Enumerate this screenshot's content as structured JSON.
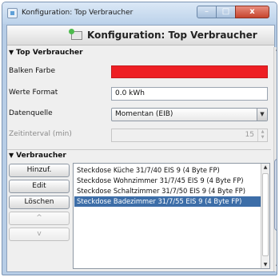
{
  "window": {
    "title": "Konfiguration: Top Verbraucher",
    "minimize_glyph": "–",
    "maximize_glyph": "□",
    "close_glyph": "x"
  },
  "header": {
    "title": "Konfiguration: Top Verbraucher",
    "icon": "add-widget-icon"
  },
  "settings": {
    "section_label": "Top Verbraucher",
    "rows": [
      {
        "label": "Balken Farbe",
        "value": "#ee1f24"
      },
      {
        "label": "Werte Format",
        "value": "0.0 kWh"
      },
      {
        "label": "Datenquelle",
        "value": "Momentan (EIB)"
      },
      {
        "label": "Zeitinterval (min)",
        "value": "15"
      }
    ]
  },
  "consumers": {
    "section_label": "Verbraucher",
    "buttons": [
      {
        "label": "Hinzuf."
      },
      {
        "label": "Edit"
      },
      {
        "label": "Löschen"
      },
      {
        "label": "^"
      },
      {
        "label": "v"
      }
    ],
    "items": [
      "Steckdose Küche 31/7/40 EIS 9 (4 Byte FP)",
      "Steckdose Wohnzimmer 31/7/45 EIS 9 (4 Byte FP)",
      "Steckdose Schaltzimmer 31/7/50 EIS 9 (4 Byte FP)",
      "Steckdose Badezimmer 31/7/55 EIS 9 (4 Byte FP)"
    ],
    "selected_index": 3
  },
  "colors": {
    "bar_color": "#ee1f24",
    "selection": "#3d6ea8",
    "title_bar": "#bcd2ea"
  }
}
